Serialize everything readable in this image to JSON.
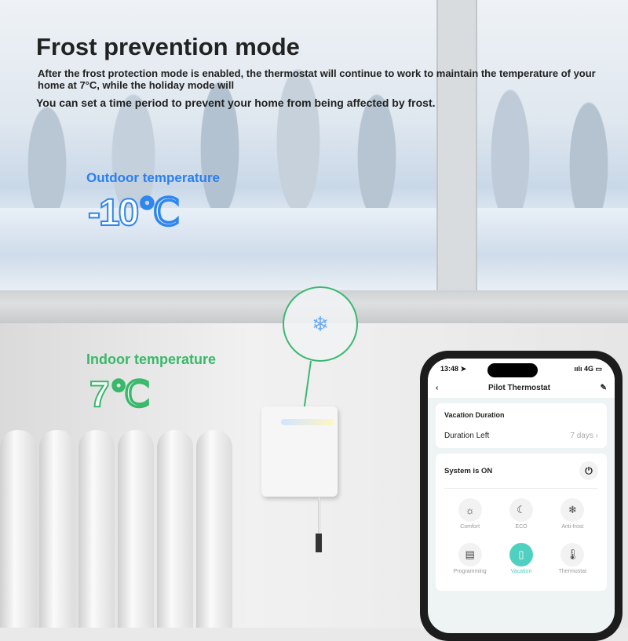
{
  "heading": "Frost prevention mode",
  "description": "After the frost protection mode is enabled, the thermostat will continue to work to maintain the temperature of your home at 7°C, while the holiday mode will",
  "description2": "You can set a time period to prevent your home from being affected by frost.",
  "outdoor": {
    "label": "Outdoor temperature",
    "value": "-10℃"
  },
  "indoor": {
    "label": "Indoor temperature",
    "value": "7℃"
  },
  "colors": {
    "outdoor": "#2f86ee",
    "indoor": "#39b86a",
    "accent": "#4fd0c0"
  },
  "phone": {
    "time": "13:48 ➤",
    "signal": "ıılı 4G ▭",
    "title": "Pilot Thermostat",
    "vacation": {
      "title": "Vacation Duration",
      "row_label": "Duration Left",
      "row_value": "7 days"
    },
    "system_status": "System is ON",
    "modes": [
      {
        "label": "Comfort",
        "icon": "sun-icon",
        "glyph": "☼"
      },
      {
        "label": "ECO",
        "icon": "moon-icon",
        "glyph": "☾"
      },
      {
        "label": "Anti-frost",
        "icon": "snowflake-icon",
        "glyph": "❄"
      },
      {
        "label": "Programming",
        "icon": "schedule-icon",
        "glyph": "▤"
      },
      {
        "label": "Vacation",
        "icon": "suitcase-icon",
        "glyph": "▯",
        "active": true
      },
      {
        "label": "Thermostat",
        "icon": "thermometer-icon",
        "glyph": "🌡"
      }
    ]
  }
}
